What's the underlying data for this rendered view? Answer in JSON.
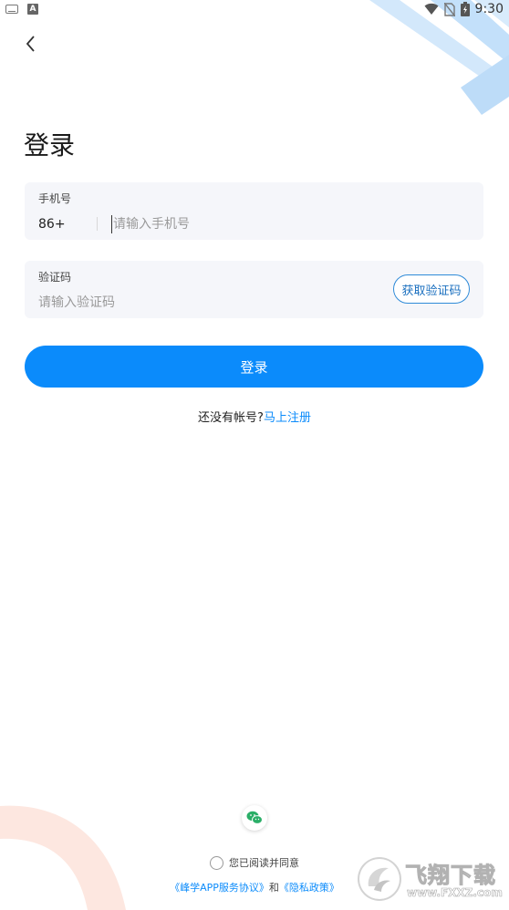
{
  "status_bar": {
    "left_icons": [
      "keyboard-icon",
      "a-notification-icon"
    ],
    "right_icons": [
      "wifi-icon",
      "no-sim-icon",
      "battery-charging-icon"
    ],
    "time": "9:30"
  },
  "nav": {
    "back_icon": "chevron-left-icon"
  },
  "page": {
    "title": "登录"
  },
  "phone_field": {
    "label": "手机号",
    "prefix": "86+",
    "placeholder": "请输入手机号",
    "value": ""
  },
  "code_field": {
    "label": "验证码",
    "placeholder": "请输入验证码",
    "value": "",
    "button_label": "获取验证码"
  },
  "login_button": {
    "label": "登录"
  },
  "register": {
    "prompt": "还没有帐号?",
    "link": "马上注册"
  },
  "social": {
    "wechat_icon": "wechat-icon"
  },
  "agreement": {
    "text": "您已阅读并同意",
    "checked": false,
    "service_link": "《峰学APP服务协议》",
    "conjunction": "和",
    "privacy_link": "《隐私政策》"
  },
  "watermark": {
    "text": "飞翔下载",
    "url": "www.FXXZ.com"
  },
  "colors": {
    "accent": "#0b8bfb",
    "field_bg": "#f5f6fa",
    "deco_blue": "#cfe6fb",
    "deco_orange": "#fde9e3"
  }
}
